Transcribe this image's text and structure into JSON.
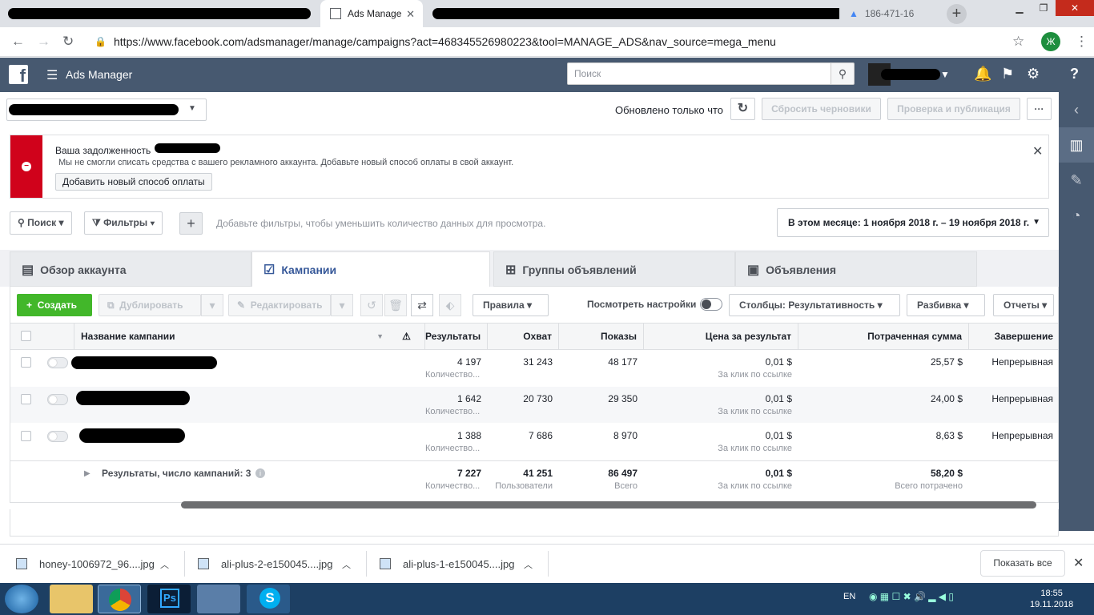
{
  "browser": {
    "tabs": [
      {
        "label": "Ads Manage",
        "active": true
      },
      {
        "label": "186-471-16",
        "active": false
      }
    ],
    "url": "https://www.facebook.com/adsmanager/manage/campaigns?act=468345526980223&tool=MANAGE_ADS&nav_source=mega_menu",
    "profile_letter": "Ж"
  },
  "header": {
    "logo": "f",
    "title": "Ads Manager",
    "search_placeholder": "Поиск"
  },
  "toolbar": {
    "updated": "Обновлено только что",
    "discard": "Сбросить черновики",
    "review": "Проверка и публикация",
    "more": "···"
  },
  "alert": {
    "title": "Ваша задолженность",
    "text": "Мы не смогли списать средства с вашего рекламного аккаунта. Добавьте новый способ оплаты в свой аккаунт.",
    "button": "Добавить новый способ оплаты"
  },
  "filters": {
    "search": "Поиск",
    "filters": "Фильтры",
    "hint": "Добавьте фильтры, чтобы уменьшить количество данных для просмотра.",
    "date_range": "В этом месяце: 1 ноября 2018 г. – 19 ноября 2018 г."
  },
  "page_tabs": [
    {
      "label": "Обзор аккаунта"
    },
    {
      "label": "Кампании"
    },
    {
      "label": "Группы объявлений"
    },
    {
      "label": "Объявления"
    }
  ],
  "actions": {
    "create": "Создать",
    "duplicate": "Дублировать",
    "edit": "Редактировать",
    "rules": "Правила",
    "view_settings": "Посмотреть настройки",
    "columns": "Столбцы: Результативность",
    "breakdown": "Разбивка",
    "reports": "Отчеты"
  },
  "table": {
    "headers": [
      "Название кампании",
      "Результаты",
      "Охват",
      "Показы",
      "Цена за результат",
      "Потраченная сумма",
      "Завершение"
    ],
    "rows": [
      {
        "results": "4 197",
        "results_sub": "Количество...",
        "reach": "31 243",
        "impressions": "48 177",
        "cpr": "0,01 $",
        "cpr_sub": "За клик по ссылке",
        "spent": "25,57 $",
        "end": "Непрерывная"
      },
      {
        "results": "1 642",
        "results_sub": "Количество...",
        "reach": "20 730",
        "impressions": "29 350",
        "cpr": "0,01 $",
        "cpr_sub": "За клик по ссылке",
        "spent": "24,00 $",
        "end": "Непрерывная"
      },
      {
        "results": "1 388",
        "results_sub": "Количество...",
        "reach": "7 686",
        "impressions": "8 970",
        "cpr": "0,01 $",
        "cpr_sub": "За клик по ссылке",
        "spent": "8,63 $",
        "end": "Непрерывная"
      }
    ],
    "total": {
      "label": "Результаты, число кампаний: 3",
      "results": "7 227",
      "results_sub": "Количество...",
      "reach": "41 251",
      "reach_sub": "Пользователи",
      "impressions": "86 497",
      "impressions_sub": "Всего",
      "cpr": "0,01 $",
      "cpr_sub": "За клик по ссылке",
      "spent": "58,20 $",
      "spent_sub": "Всего потрачено"
    }
  },
  "downloads": {
    "files": [
      "honey-1006972_96....jpg",
      "ali-plus-2-e150045....jpg",
      "ali-plus-1-e150045....jpg"
    ],
    "show_all": "Показать все"
  },
  "taskbar": {
    "lang": "EN",
    "time": "18:55",
    "date": "19.11.2018"
  },
  "colors": {
    "fb_bar": "#475970",
    "create_green": "#42b72a",
    "alert_red": "#d0021b",
    "link_blue": "#365899"
  }
}
